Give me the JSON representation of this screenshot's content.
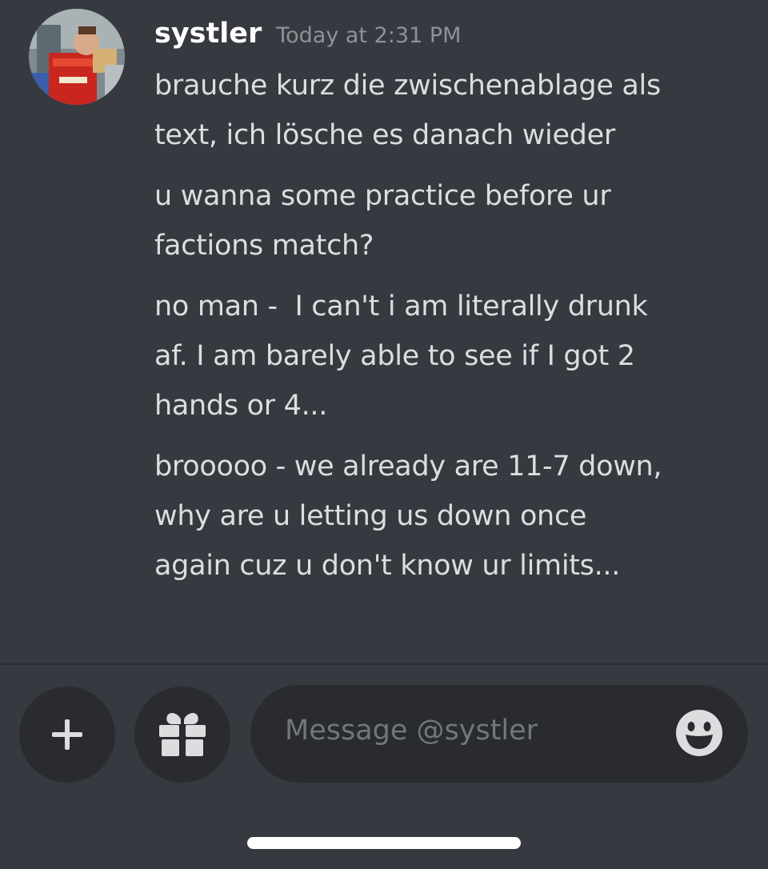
{
  "message": {
    "author": "systler",
    "timestamp": "Today at 2:31 PM",
    "lines": [
      "brauche kurz die zwischenablage als\ntext, ich lösche es danach wieder",
      "u wanna some practice before ur\nfactions match?",
      "no man -  I can't i am literally drunk\naf. I am barely able to see if I got 2\nhands or 4...",
      "brooooo - we already are 11-7 down,\nwhy are u letting us down once\nagain cuz u don't know ur limits..."
    ]
  },
  "composer": {
    "placeholder": "Message @systler",
    "buttons": {
      "add": "plus-icon",
      "gift": "gift-icon",
      "emoji": "smile-emoji-icon"
    }
  },
  "colors": {
    "background": "#36393f",
    "input_background": "#292b2f",
    "username": "#ffffff",
    "message_text": "#dcddde",
    "muted": "#8e9297"
  }
}
